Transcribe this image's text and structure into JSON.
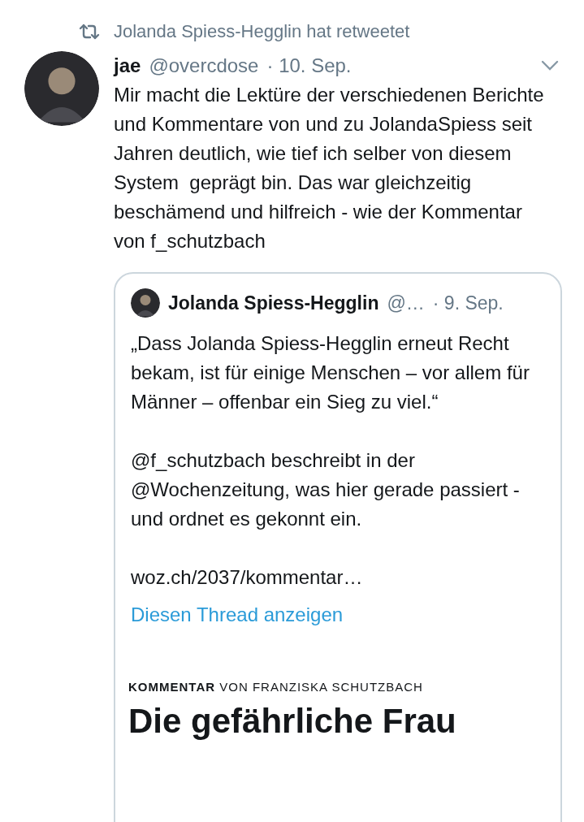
{
  "retweet_banner": {
    "text": "Jolanda Spiess-Hegglin hat retweetet"
  },
  "tweet": {
    "name": "jae",
    "handle": "@overcdose",
    "date": "· 10. Sep.",
    "text": "Mir macht die Lektüre der verschiedenen Berichte und Kommentare von und zu JolandaSpiess seit Jahren deutlich, wie tief ich selber von diesem System  geprägt bin. Das war gleichzeitig beschämend und hilfreich - wie der Kommentar von f_schutzbach",
    "quoted": {
      "name": "Jolanda Spiess-Hegglin",
      "handle": "@…",
      "date": "· 9. Sep.",
      "paragraphs": [
        "„Dass Jolanda Spiess-Hegglin erneut Recht bekam, ist für einige Menschen – vor allem für Männer – offenbar ein Sieg zu viel.“",
        "@f_schutzbach beschreibt in der @Wochenzeitung, was hier gerade passiert - und ordnet es gekonnt ein.",
        "woz.ch/2037/kommentar…"
      ],
      "thread_link": "Diesen Thread anzeigen",
      "article": {
        "kicker_bold": "KOMMENTAR",
        "kicker": "VON FRANZISKA SCHUTZBACH",
        "headline": "Die gefährliche Frau"
      }
    }
  }
}
